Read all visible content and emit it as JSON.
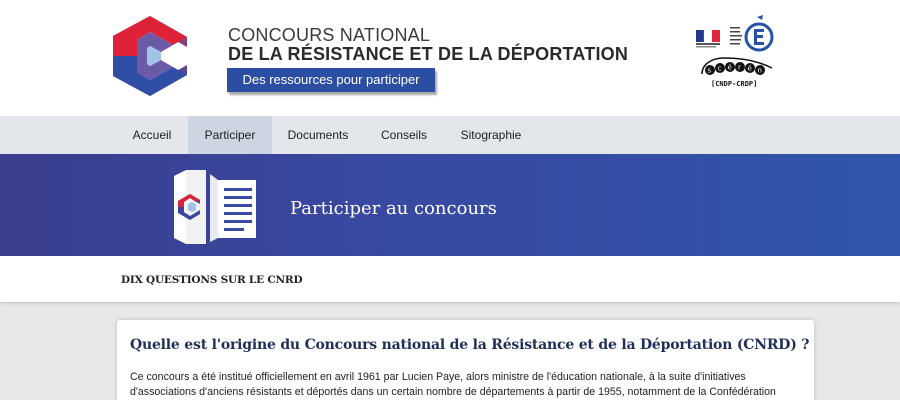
{
  "header": {
    "title_line1": "CONCOURS NATIONAL",
    "title_line2": "DE LA RÉSISTANCE ET DE LA DÉPORTATION",
    "subtitle_button": "Des ressources pour participer",
    "logo_ministere_icon": "ministere-education-nationale-logo",
    "logo_sceren_icon": "sceren-logo",
    "sceren_label": "[CNDP-CRDP]",
    "brand_logo_icon": "cnrd-c-logo"
  },
  "nav": {
    "items": [
      {
        "label": "Accueil",
        "active": false
      },
      {
        "label": "Participer",
        "active": true
      },
      {
        "label": "Documents",
        "active": false
      },
      {
        "label": "Conseils",
        "active": false
      },
      {
        "label": "Sitographie",
        "active": false
      }
    ]
  },
  "banner": {
    "title": "Participer au concours",
    "icon": "document-pages-icon"
  },
  "section": {
    "label": "DIX QUESTIONS SUR LE CNRD"
  },
  "article": {
    "question": "Quelle est l'origine du Concours national de la Résistance et de la Déportation (CNRD) ?",
    "paragraph": "Ce concours a été institué officiellement en avril 1961 par Lucien Paye, alors ministre de l'éducation nationale, à la suite d'initiatives d'associations d'anciens résistants et déportés dans un certain nombre de départements à partir de 1955, notamment de la Confédération nationale des combattants"
  },
  "colors": {
    "brand_blue": "#2b4ea3",
    "brand_red": "#d8213b",
    "banner_blue": "#3948a0",
    "nav_bg": "#e3e6ea",
    "nav_active": "#cdd5e2",
    "question_text": "#1f2f57"
  }
}
